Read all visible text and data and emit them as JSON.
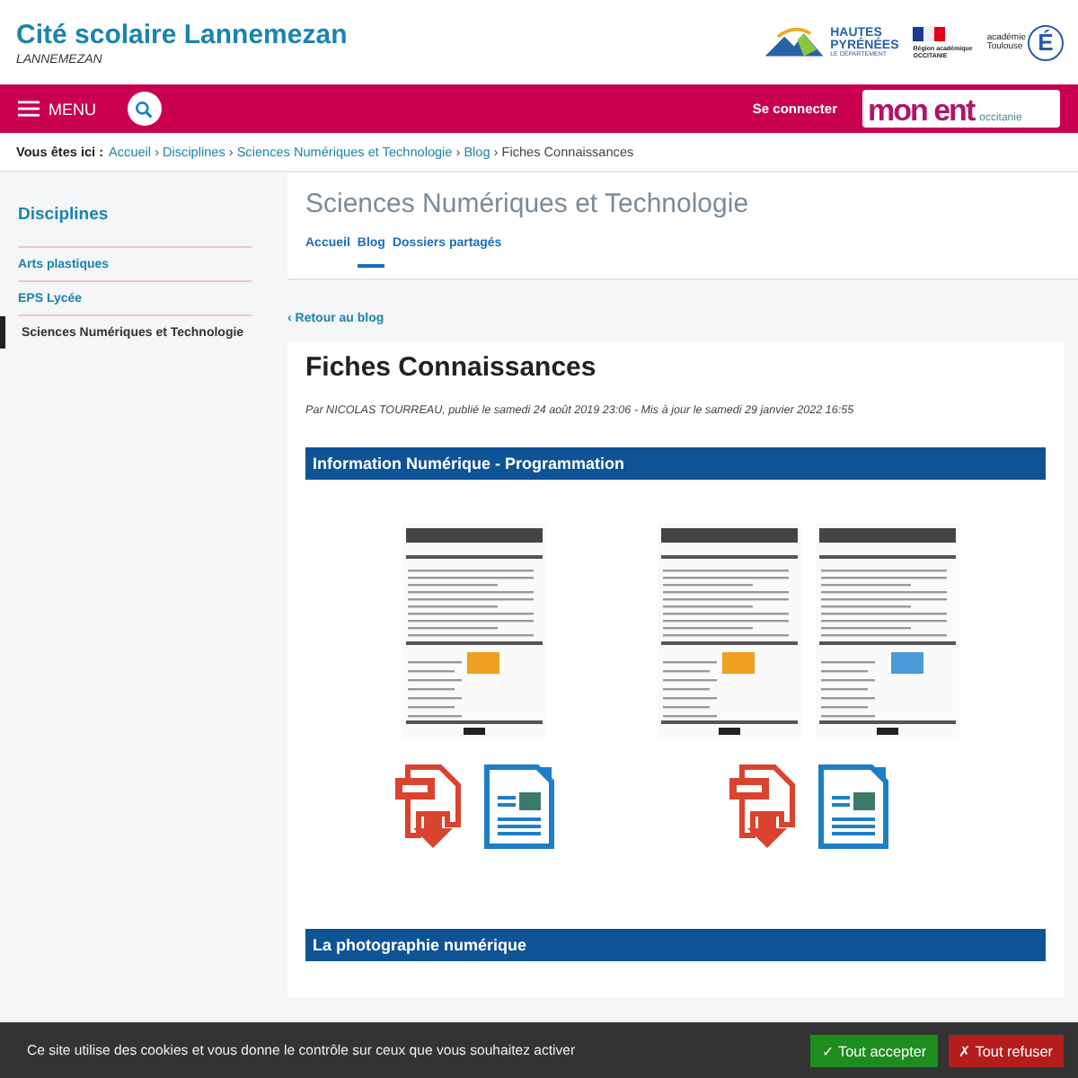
{
  "header": {
    "site_title": "Cité scolaire Lannemezan",
    "subtitle": "LANNEMEZAN",
    "logos": [
      {
        "kind": "department",
        "lines": [
          "HAUTES",
          "PYRÉNÉES",
          "LE DÉPARTEMENT"
        ]
      },
      {
        "kind": "region",
        "lines": [
          "Région académique",
          "OCCITANIE"
        ]
      },
      {
        "kind": "academie",
        "lines": [
          "académie",
          "Toulouse"
        ],
        "mark": "É"
      }
    ]
  },
  "navbar": {
    "menu_label": "MENU",
    "login": "Se connecter",
    "ent_logo": {
      "main": "mon ent",
      "sub": "occitanie"
    }
  },
  "breadcrumb": {
    "label": "Vous êtes ici :",
    "separator": "›",
    "items": [
      {
        "label": "Accueil",
        "kind": "link"
      },
      {
        "label": "Disciplines",
        "kind": "link"
      },
      {
        "label": "Sciences Numériques et Technologie",
        "kind": "link"
      },
      {
        "label": "Blog",
        "kind": "link"
      },
      {
        "label": "Fiches Connaissances",
        "kind": "current"
      }
    ]
  },
  "sidebar": {
    "title": "Disciplines",
    "items": [
      {
        "label": "Arts plastiques",
        "selected": false
      },
      {
        "label": "EPS Lycée",
        "selected": false
      },
      {
        "label": "Sciences Numériques et Technologie",
        "selected": true
      }
    ]
  },
  "section": {
    "title": "Sciences Numériques et Technologie",
    "tabs": [
      {
        "label": "Accueil",
        "selected": false
      },
      {
        "label": "Blog",
        "selected": true
      },
      {
        "label": "Dossiers partagés",
        "selected": false
      }
    ]
  },
  "back_link": "‹ Retour au blog",
  "article": {
    "title": "Fiches Connaissances",
    "meta": "Par NICOLAS TOURREAU, publié le samedi 24 août 2019 23:06 - Mis à jour le samedi 29 janvier 2022 16:55",
    "sections": [
      {
        "heading": "Information Numérique - Programmation",
        "documents": [
          {
            "kind": "single"
          },
          {
            "kind": "double"
          }
        ]
      },
      {
        "heading": "La photographie numérique"
      }
    ]
  },
  "cookie_bar": {
    "text": "Ce site utilise des cookies et vous donne le contrôle sur ceux que vous souhaitez activer",
    "buttons": [
      {
        "label": "✓ Tout accepter",
        "kind": "accept"
      },
      {
        "label": "✗ Tout refuser",
        "kind": "refuse"
      }
    ]
  }
}
